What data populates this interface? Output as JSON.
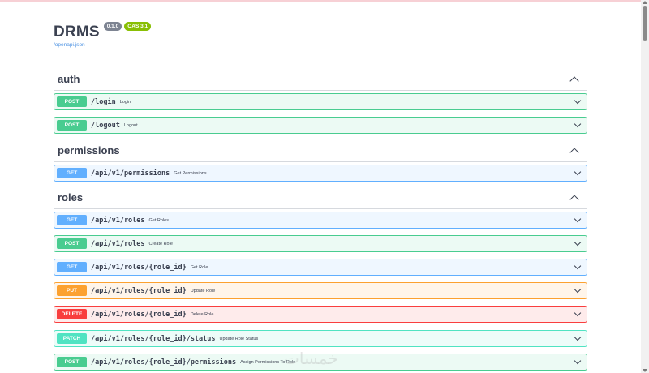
{
  "app": {
    "title": "DRMS",
    "version_badge": "0.1.0",
    "oas_badge": "OAS 3.1",
    "spec_link": "/openapi.json"
  },
  "sections": [
    {
      "name": "auth",
      "operations": [
        {
          "method": "POST",
          "path": "/login",
          "summary": "Login"
        },
        {
          "method": "POST",
          "path": "/logout",
          "summary": "Logout"
        }
      ]
    },
    {
      "name": "permissions",
      "operations": [
        {
          "method": "GET",
          "path": "/api/v1/permissions",
          "summary": "Get Permissions"
        }
      ]
    },
    {
      "name": "roles",
      "operations": [
        {
          "method": "GET",
          "path": "/api/v1/roles",
          "summary": "Get Roles"
        },
        {
          "method": "POST",
          "path": "/api/v1/roles",
          "summary": "Create Role"
        },
        {
          "method": "GET",
          "path": "/api/v1/roles/{role_id}",
          "summary": "Get Role"
        },
        {
          "method": "PUT",
          "path": "/api/v1/roles/{role_id}",
          "summary": "Update Role"
        },
        {
          "method": "DELETE",
          "path": "/api/v1/roles/{role_id}",
          "summary": "Delete Role"
        },
        {
          "method": "PATCH",
          "path": "/api/v1/roles/{role_id}/status",
          "summary": "Update Role Status"
        },
        {
          "method": "POST",
          "path": "/api/v1/roles/{role_id}/permissions",
          "summary": "Assign Permissions To Role"
        }
      ]
    }
  ],
  "watermark": "خمسات",
  "colors": {
    "post": "#49cc90",
    "get": "#61affe",
    "put": "#fca130",
    "delete": "#f93e3e",
    "patch": "#50e3c2"
  }
}
